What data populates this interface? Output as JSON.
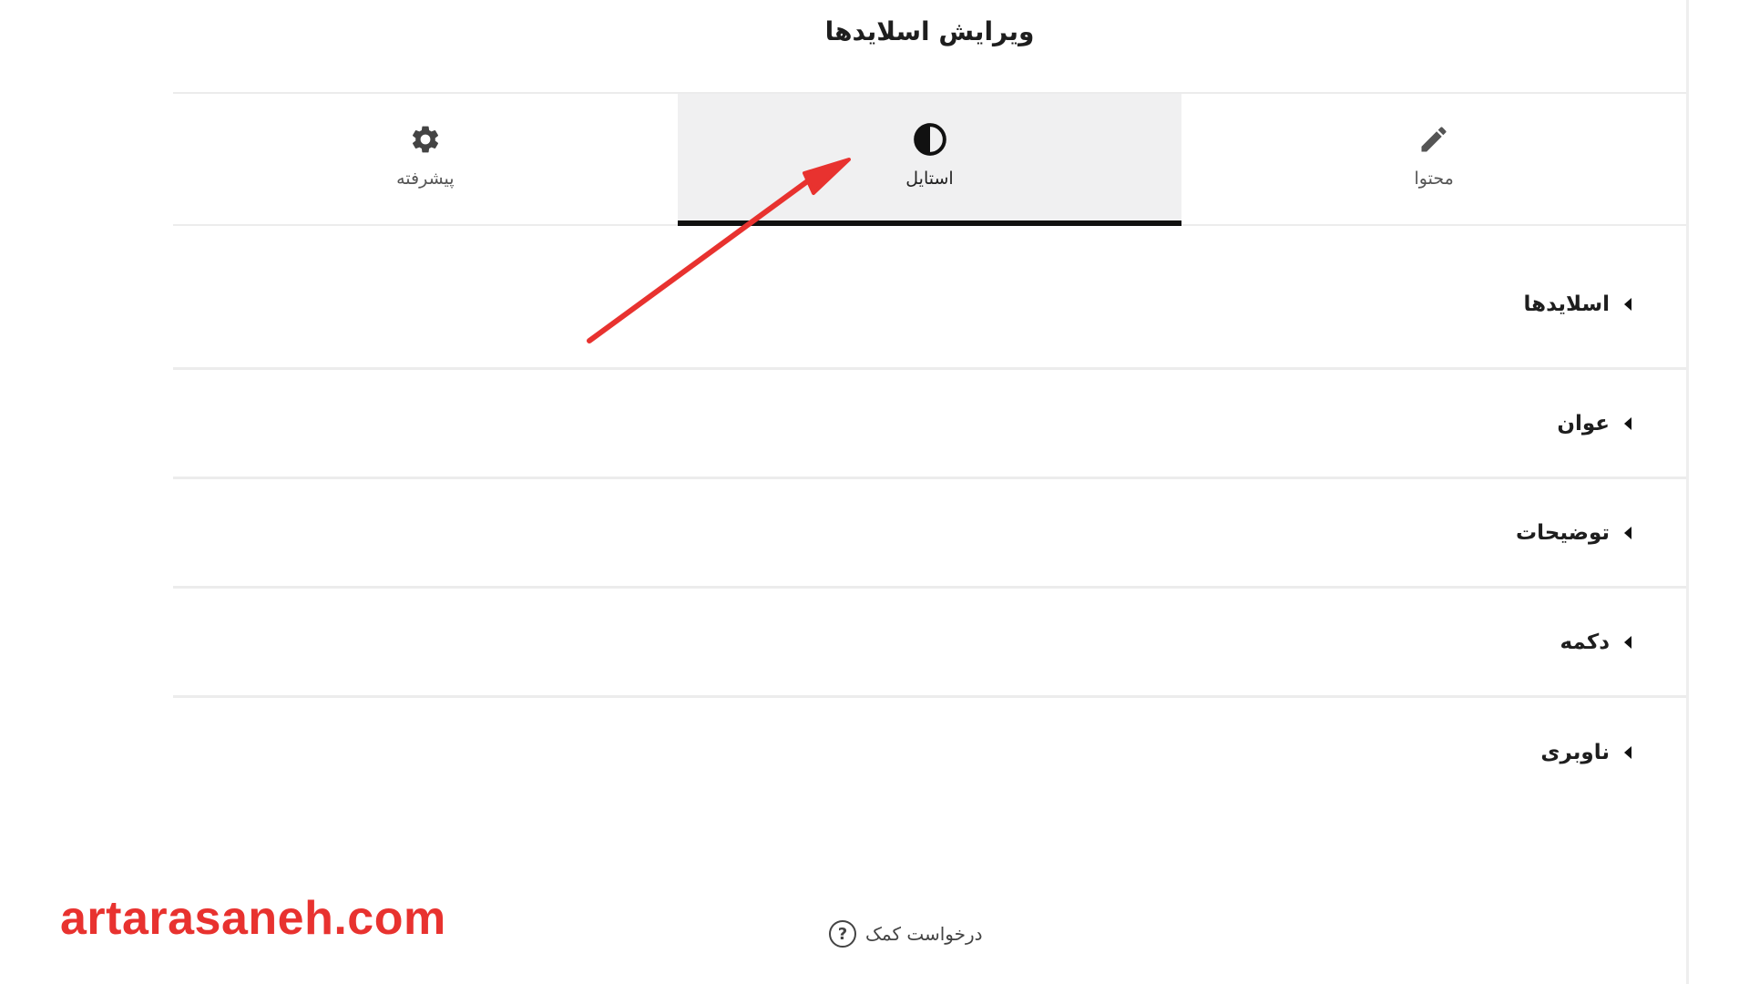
{
  "header": {
    "title": "ویرایش اسلایدها"
  },
  "tabs": [
    {
      "label": "پیشرفته",
      "icon": "gear-icon",
      "active": false
    },
    {
      "label": "استایل",
      "icon": "contrast-icon",
      "active": true
    },
    {
      "label": "محتوا",
      "icon": "pencil-icon",
      "active": false
    }
  ],
  "sections": [
    {
      "label": "اسلایدها",
      "icon": "caret-left-icon"
    },
    {
      "label": "عوان",
      "icon": "caret-left-icon"
    },
    {
      "label": "توضیحات",
      "icon": "caret-left-icon"
    },
    {
      "label": "دکمه",
      "icon": "caret-left-icon"
    },
    {
      "label": "ناوبری",
      "icon": "caret-left-icon"
    }
  ],
  "footer": {
    "help_label": "درخواست کمک",
    "help_icon_glyph": "?"
  },
  "watermark": {
    "text": "artarasaneh.com"
  },
  "colors": {
    "watermark": "#e8322f",
    "annotation_arrow": "#e8322f",
    "active_tab_bg": "#f0f0f1",
    "active_tab_indicator": "#111111"
  }
}
